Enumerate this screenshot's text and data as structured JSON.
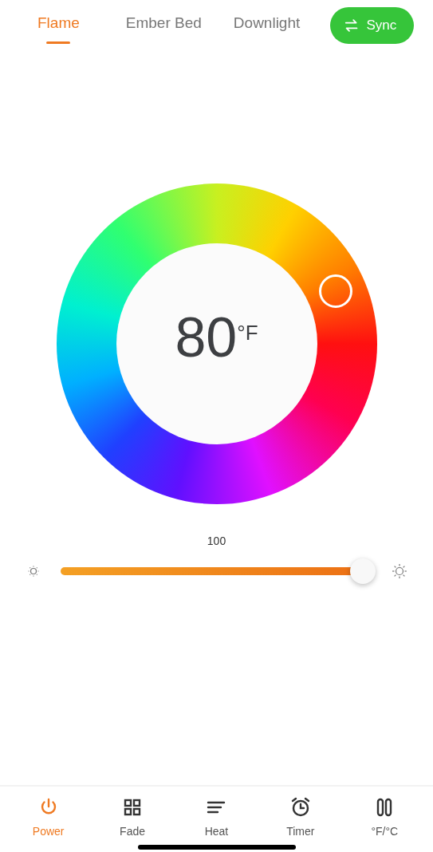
{
  "tabs": [
    {
      "label": "Flame",
      "selected": true
    },
    {
      "label": "Ember Bed",
      "selected": false
    },
    {
      "label": "Downlight",
      "selected": false
    }
  ],
  "sync_button": {
    "label": "Sync"
  },
  "temperature": {
    "value": "80",
    "unit": "°F"
  },
  "brightness": {
    "reading": "100",
    "level": 1.0
  },
  "bottom_nav": [
    {
      "label": "Power",
      "kind": "power",
      "selected": true
    },
    {
      "label": "Fade",
      "kind": "grid",
      "selected": false
    },
    {
      "label": "Heat",
      "kind": "lines",
      "selected": false
    },
    {
      "label": "Timer",
      "kind": "alarm",
      "selected": false
    },
    {
      "label": "°F/°C",
      "kind": "units",
      "selected": false
    }
  ]
}
